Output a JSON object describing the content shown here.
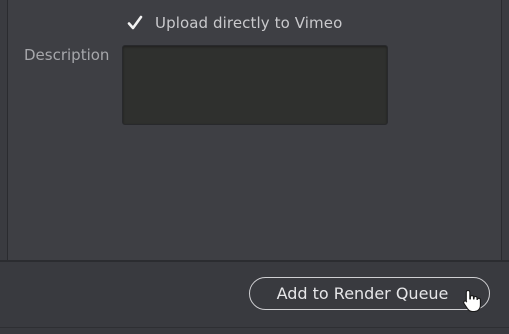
{
  "upload": {
    "checked": true,
    "label": "Upload directly to Vimeo"
  },
  "description": {
    "label": "Description",
    "value": ""
  },
  "footer": {
    "add_button_label": "Add to Render Queue"
  },
  "icons": {
    "checkbox": "checkmark-icon",
    "cursor": "hand-pointer-cursor-icon"
  }
}
